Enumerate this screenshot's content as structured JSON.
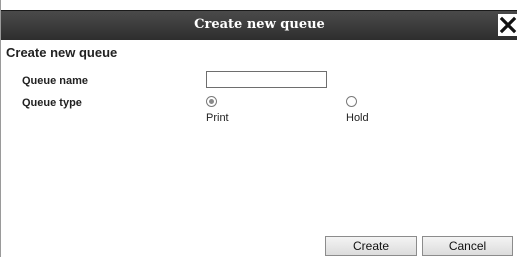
{
  "dialog": {
    "title": "Create new queue",
    "heading": "Create new queue"
  },
  "form": {
    "queue_name_label": "Queue name",
    "queue_name_value": "",
    "queue_type_label": "Queue type",
    "queue_type_options": [
      {
        "label": "Print",
        "selected": true
      },
      {
        "label": "Hold",
        "selected": false
      }
    ]
  },
  "buttons": {
    "create": "Create",
    "cancel": "Cancel"
  },
  "icons": {
    "close": "close-icon"
  }
}
